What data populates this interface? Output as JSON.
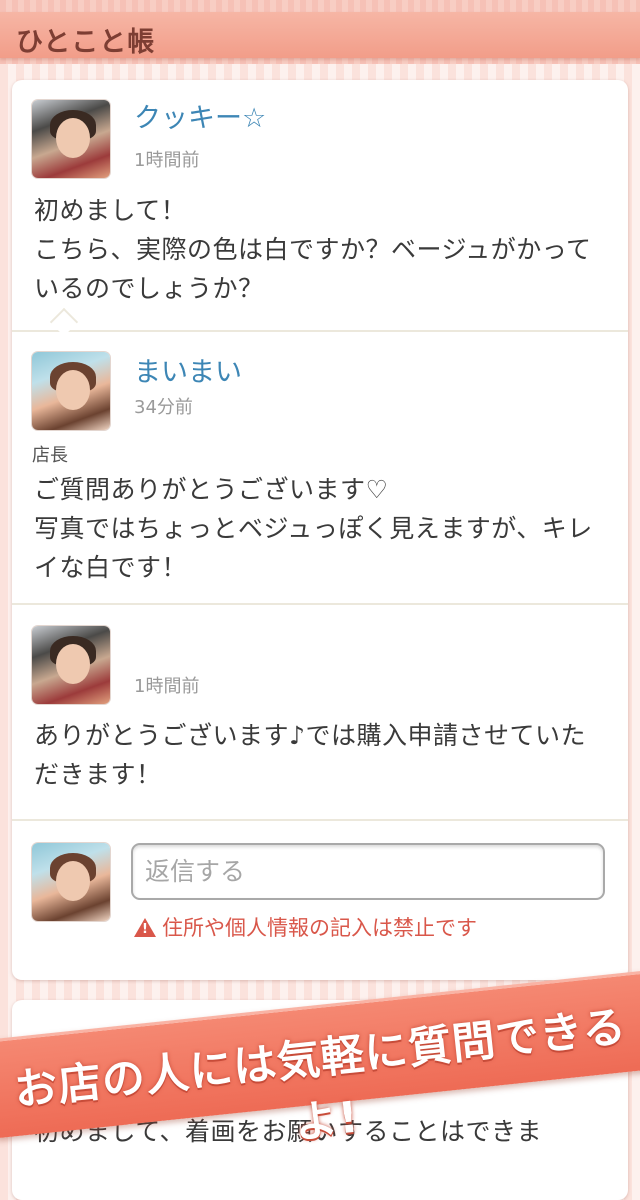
{
  "header": {
    "title": "ひとこと帳"
  },
  "thread": {
    "posts": [
      {
        "avatar": "avatar-photo-cookie",
        "name": "クッキー☆",
        "time": "1時間前",
        "message": "初めまして！\nこちら、実際の色は白ですか？ベージュがかっているのでしょうか？"
      },
      {
        "avatar": "avatar-photo-maimai",
        "name": "まいまい",
        "time": "34分前",
        "role": "店長",
        "message": "ご質問ありがとうございます♡\n写真ではちょっとベジュっぽく見えますが、キレイな白です！"
      },
      {
        "avatar": "avatar-photo-cookie",
        "name": "",
        "time": "1時間前",
        "message": "ありがとうございます♪では購入申請させていただきます！"
      }
    ],
    "reply": {
      "placeholder": "返信する",
      "warning": "住所や個人情報の記入は禁止です",
      "warning_icon": "warning-icon"
    }
  },
  "next_post": {
    "message": "初めまして、着画をお願いすることはできま"
  },
  "banner": {
    "text": "お店の人には気軽に質問できるよ!"
  },
  "colors": {
    "accent": "#f29d89",
    "name_link": "#3d86b5",
    "warning": "#d9574a",
    "banner": "#ee6b55"
  }
}
